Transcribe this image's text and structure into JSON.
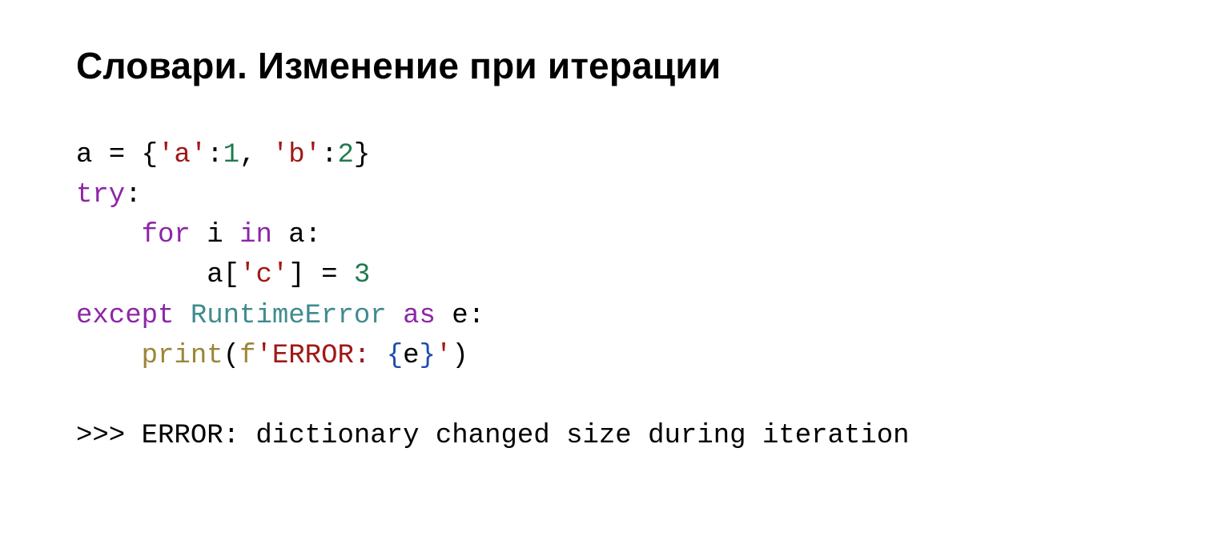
{
  "title": "Словари. Изменение при итерации",
  "code": {
    "l1": {
      "t1": "a = {",
      "s1": "'a'",
      "t2": ":",
      "n1": "1",
      "t3": ", ",
      "s2": "'b'",
      "t4": ":",
      "n2": "2",
      "t5": "}"
    },
    "l2": {
      "k1": "try",
      "t1": ":"
    },
    "l3": {
      "k1": "for",
      "t1": " i ",
      "k2": "in",
      "t2": " a:"
    },
    "l4": {
      "t1": "a[",
      "s1": "'c'",
      "t2": "] = ",
      "n1": "3"
    },
    "l5": {
      "k1": "except",
      "t1": " ",
      "c1": "RuntimeError",
      "t2": " ",
      "k2": "as",
      "t3": " e:"
    },
    "l6": {
      "fn": "print",
      "t1": "(",
      "fp": "f",
      "s1": "'ERROR: ",
      "b1": "{",
      "t2": "e",
      "b2": "}",
      "s2": "'",
      "t3": ")"
    }
  },
  "output": ">>> ERROR: dictionary changed size during iteration"
}
